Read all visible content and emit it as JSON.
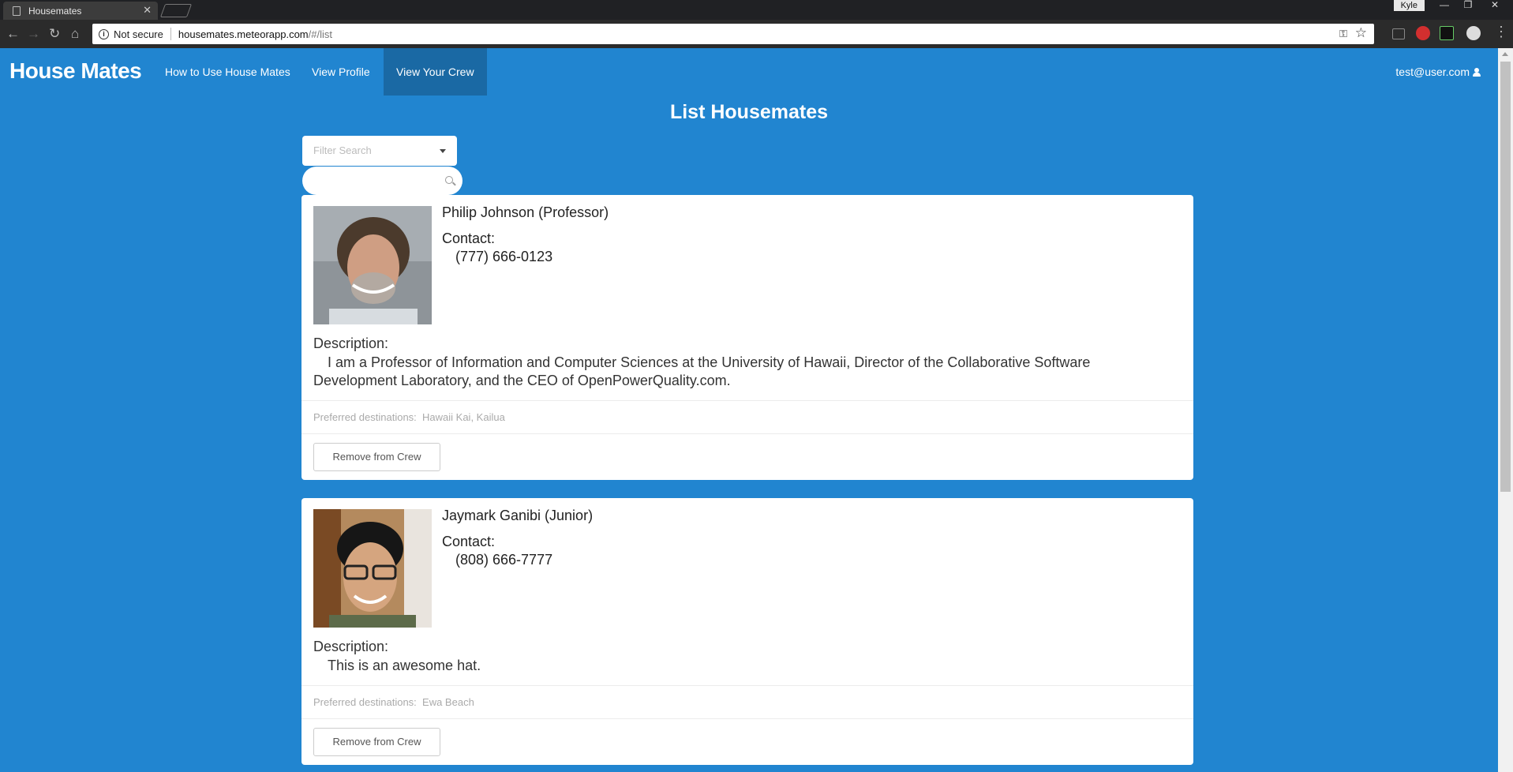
{
  "browser": {
    "tab_title": "Housemates",
    "security_label": "Not secure",
    "url_host": "housemates.meteorapp.com",
    "url_path": "/#/list",
    "profile_name": "Kyle"
  },
  "navbar": {
    "brand": "House Mates",
    "items": [
      {
        "label": "How to Use House Mates"
      },
      {
        "label": "View Profile"
      },
      {
        "label": "View Your Crew"
      }
    ],
    "user_email": "test@user.com"
  },
  "main": {
    "title": "List Housemates",
    "filter_placeholder": "Filter Search",
    "search_value": ""
  },
  "housemates": [
    {
      "header": "Philip Johnson (Professor)",
      "contact_label": "Contact:",
      "phone": "(777) 666-0123",
      "description_label": "Description:",
      "description": "I am a Professor of Information and Computer Sciences at the University of Hawaii, Director of the Collaborative Software Development Laboratory, and the CEO of OpenPowerQuality.com.",
      "preferred_label": "Preferred destinations:",
      "preferred": "Hawaii Kai, Kailua",
      "button_label": "Remove from Crew"
    },
    {
      "header": "Jaymark Ganibi (Junior)",
      "contact_label": "Contact:",
      "phone": "(808) 666-7777",
      "description_label": "Description:",
      "description": "This is an awesome hat.",
      "preferred_label": "Preferred destinations:",
      "preferred": "Ewa Beach",
      "button_label": "Remove from Crew"
    }
  ],
  "colors": {
    "page_background": "#2185d0",
    "active_nav": "#1a69a4",
    "card_background": "#ffffff"
  }
}
